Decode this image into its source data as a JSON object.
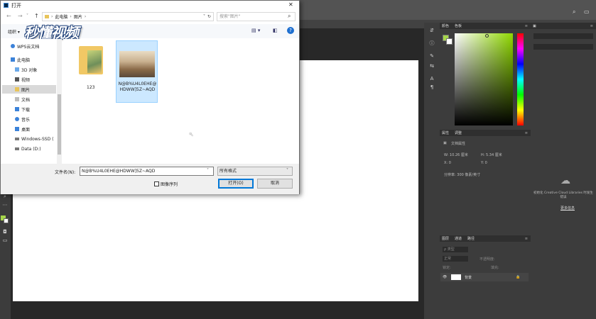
{
  "dialog": {
    "title": "打开",
    "nav": {
      "path": [
        "此电脑",
        "图片"
      ],
      "search_placeholder": "搜索\"图片\""
    },
    "toolbar": {
      "organize_label": "组织 ▾"
    },
    "watermark": "秒懂视频",
    "sidebar": {
      "items": [
        {
          "label": "WPS云文档",
          "icon": "cloud-icon"
        },
        {
          "label": "此电脑",
          "icon": "computer-icon"
        },
        {
          "label": "3D 对象",
          "icon": "cube-icon"
        },
        {
          "label": "视频",
          "icon": "video-icon"
        },
        {
          "label": "图片",
          "icon": "pictures-icon"
        },
        {
          "label": "文档",
          "icon": "document-icon"
        },
        {
          "label": "下载",
          "icon": "download-icon"
        },
        {
          "label": "音乐",
          "icon": "music-icon"
        },
        {
          "label": "桌面",
          "icon": "desktop-icon"
        },
        {
          "label": "Windows-SSD (",
          "icon": "drive-icon"
        },
        {
          "label": "Data (D:)",
          "icon": "drive-icon"
        }
      ]
    },
    "files": [
      {
        "name": "123",
        "type": "folder"
      },
      {
        "name": "N@B%U4L0EHE@HDWW]5Z~AQD",
        "type": "image",
        "selected": true
      }
    ],
    "bottom": {
      "filename_label": "文件名(N):",
      "filename_value": "N@B%U4L0EHE@HDWW]5Z~AQD",
      "filetype_value": "所有格式",
      "sequence_label": "图像序列",
      "open_label": "打开(O)",
      "cancel_label": "取消"
    }
  },
  "photoshop": {
    "color_panel": {
      "tabs": [
        "颜色",
        "色板"
      ]
    },
    "properties_panel": {
      "tabs": [
        "属性",
        "调整"
      ],
      "doc_label": "文档属性",
      "w": "W: 10.26 厘米",
      "h": "H: 5.34 厘米",
      "x": "X: 0",
      "y": "Y: 0",
      "resolution": "分辨率: 300 像素/英寸"
    },
    "layers_panel": {
      "tabs": [
        "图层",
        "通道",
        "路径"
      ],
      "kind": "ρ 类型",
      "mode": "正常",
      "opacity": "不透明度:",
      "lock": "锁定:",
      "fill": "填充:",
      "layer_name": "背景"
    },
    "libraries": {
      "message": "初始化 Creative Cloud Libraries 时发生错误",
      "link": "更多信息"
    }
  },
  "colors": {
    "accent": "#0078d7",
    "foreground": "#a6d64a"
  }
}
